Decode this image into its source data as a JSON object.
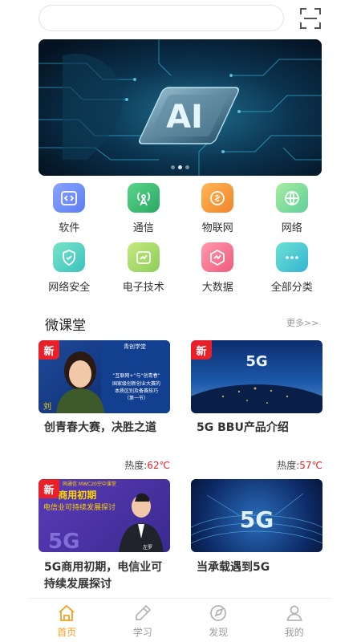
{
  "search": {
    "placeholder": ""
  },
  "banner": {
    "text": "AI",
    "slides": 3,
    "active_slide": 2
  },
  "categories": [
    {
      "label": "软件",
      "icon": "code-icon",
      "color": "#6f8cf2"
    },
    {
      "label": "通信",
      "icon": "signal-tower-icon",
      "color": "#3fbf74"
    },
    {
      "label": "物联网",
      "icon": "link-icon",
      "color": "#f6a037"
    },
    {
      "label": "网络",
      "icon": "globe-icon",
      "color": "#7fd6a0"
    },
    {
      "label": "网络安全",
      "icon": "shield-icon",
      "color": "#5bd1c0"
    },
    {
      "label": "电子技术",
      "icon": "chip-icon",
      "color": "#a6d86a"
    },
    {
      "label": "大数据",
      "icon": "chart-icon",
      "color": "#f56d8a"
    },
    {
      "label": "全部分类",
      "icon": "more-icon",
      "color": "#49c4d6"
    }
  ],
  "section": {
    "title": "微课堂",
    "more": "更多>>"
  },
  "courses": [
    {
      "title": "创青春大赛，决胜之道",
      "heat_label": "热度:",
      "heat_value": "62℃",
      "badge": "新",
      "thumb": {
        "logo": "青创学堂",
        "line1": "“互联网+”与“创青春”",
        "line2": "国家级创新创业大赛的",
        "line3": "本质区别及备赛技巧",
        "line4": "（第一节）",
        "person": "刘"
      }
    },
    {
      "title": "5G BBU产品介绍",
      "heat_label": "热度:",
      "heat_value": "57℃",
      "badge": "新",
      "thumb": {
        "text": "5G"
      }
    },
    {
      "title": "5G商用初期，电信业可持续发展探讨",
      "heat_label": "",
      "heat_value": "",
      "badge": "新",
      "thumb": {
        "header": "网通信 MWC20空中课堂",
        "line1": "5G商用初期",
        "line2": "电信业可持续发展探讨",
        "big": "5G",
        "person": "左罗"
      }
    },
    {
      "title": "当承载遇到5G",
      "heat_label": "",
      "heat_value": "",
      "badge": "",
      "thumb": {
        "text": "5G"
      }
    }
  ],
  "tabs": [
    {
      "label": "首页",
      "icon": "home-icon",
      "active": true
    },
    {
      "label": "学习",
      "icon": "pencil-icon",
      "active": false
    },
    {
      "label": "发现",
      "icon": "compass-icon",
      "active": false
    },
    {
      "label": "我的",
      "icon": "user-icon",
      "active": false
    }
  ],
  "colors": {
    "accent": "#f4a023",
    "badge": "#e8202a",
    "heat": "#e8202a"
  }
}
